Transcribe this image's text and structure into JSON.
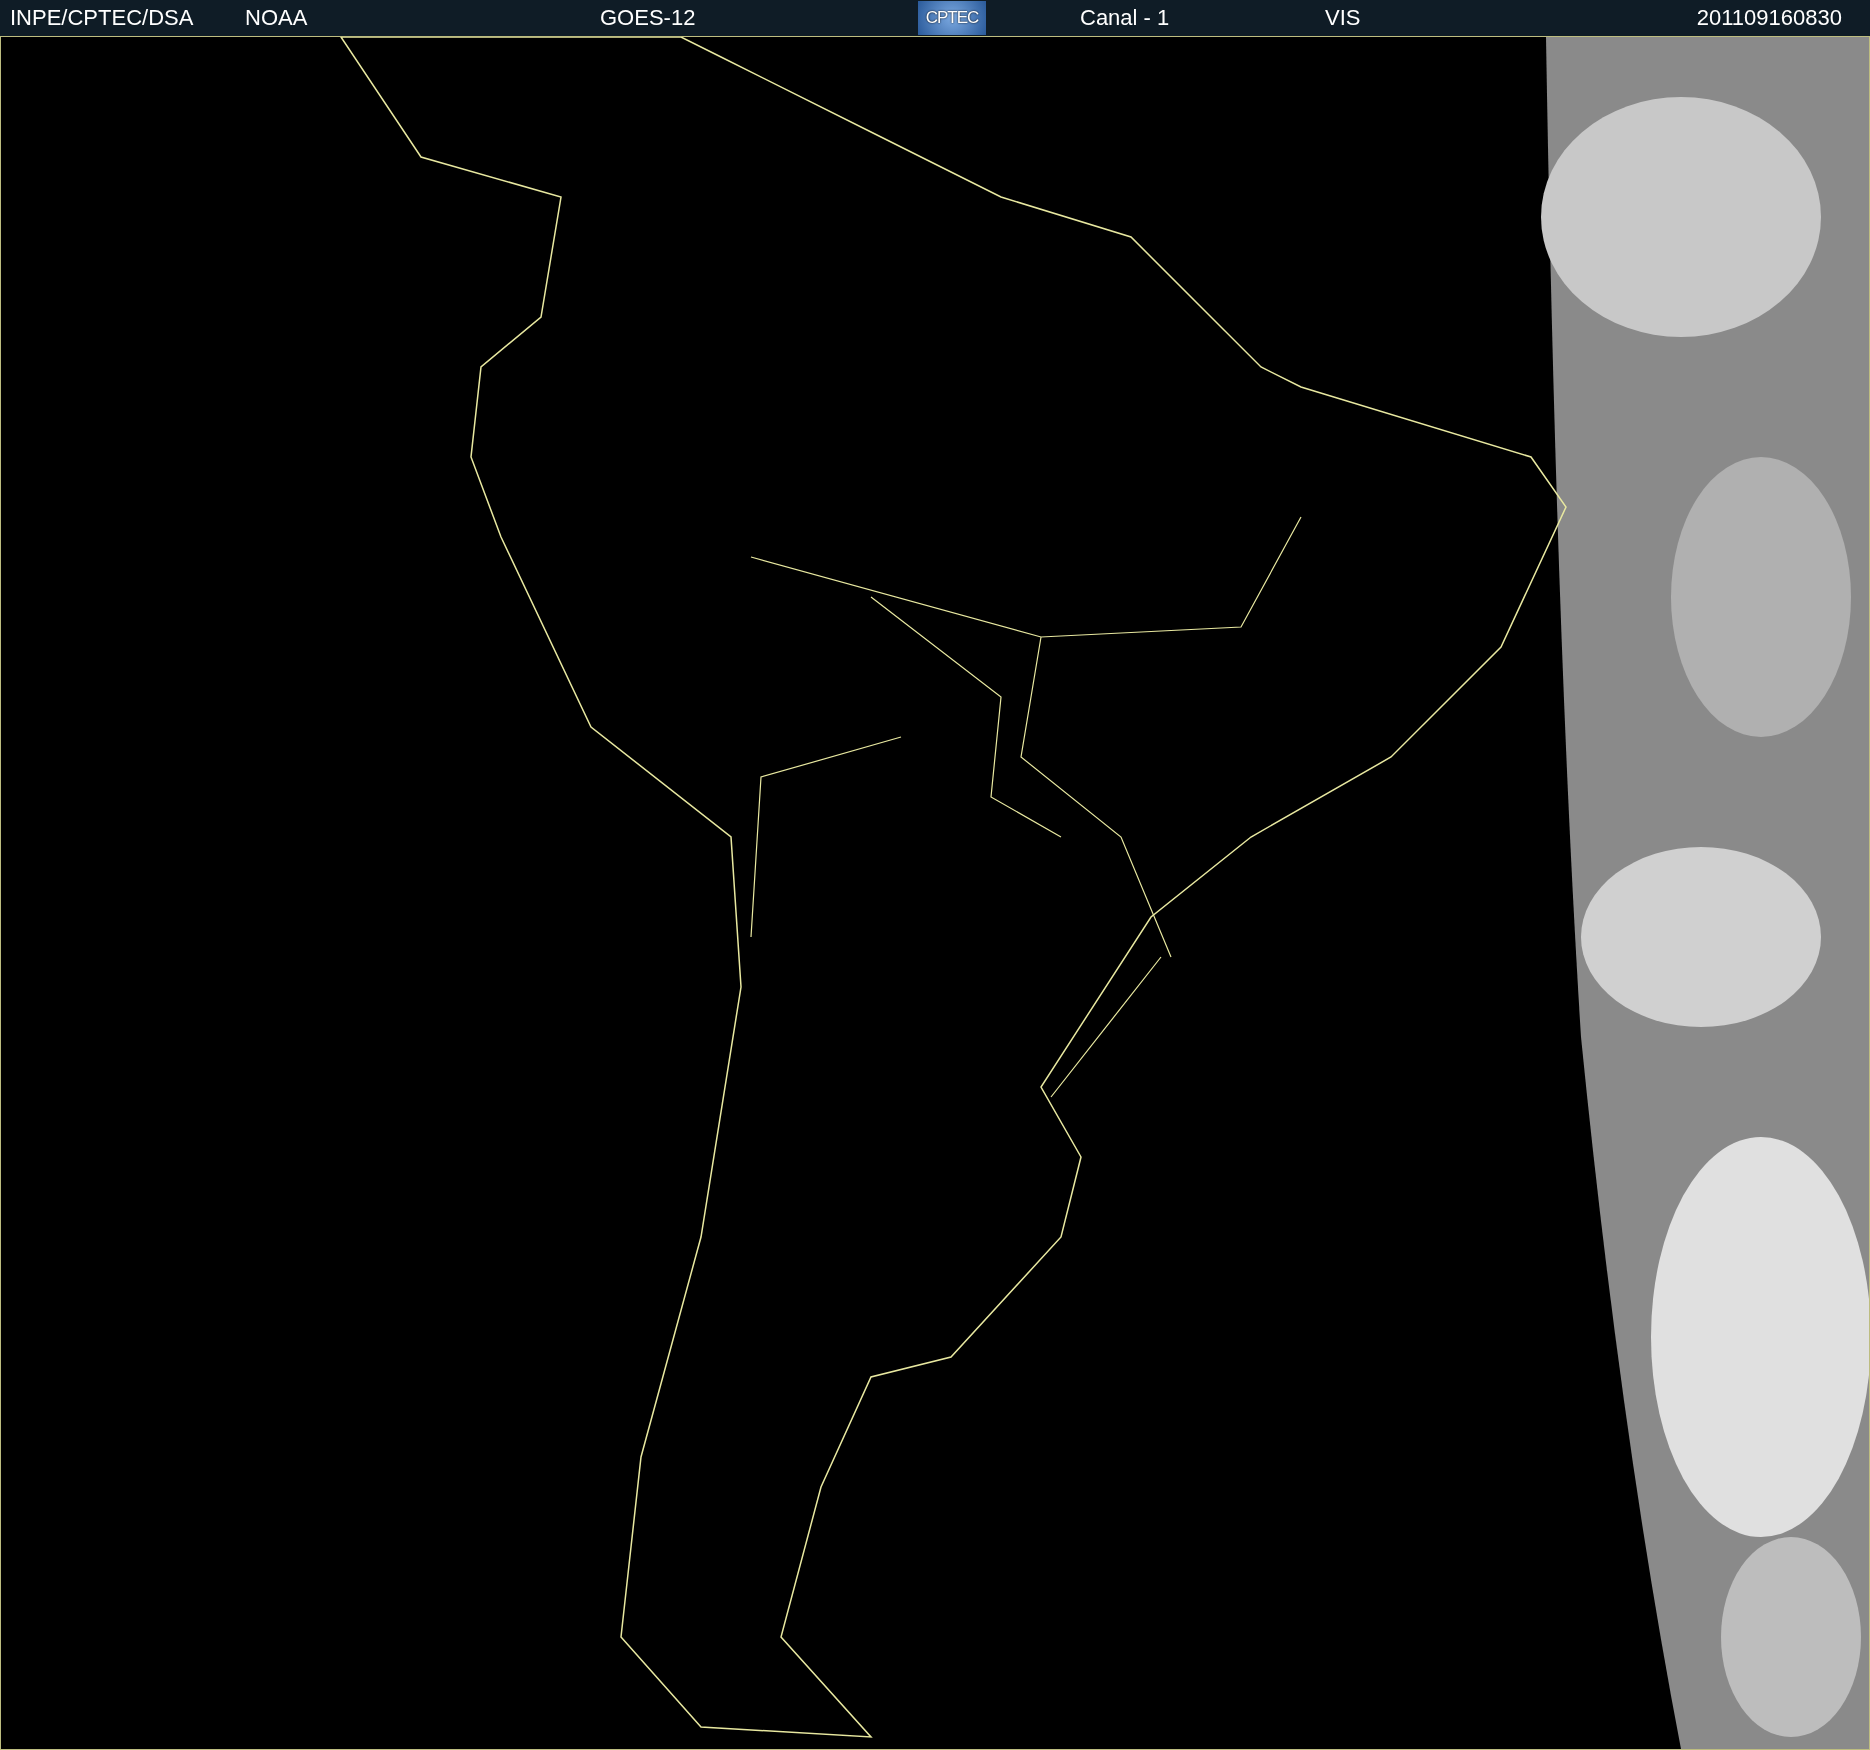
{
  "header": {
    "source": "INPE/CPTEC/DSA",
    "agency": "NOAA",
    "satellite": "GOES-12",
    "logo": "CPTEC",
    "channel": "Canal - 1",
    "band": "VIS",
    "timestamp": "201109160830"
  }
}
